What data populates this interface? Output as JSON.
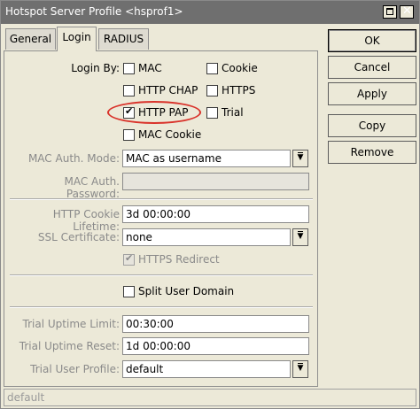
{
  "window": {
    "title": "Hotspot Server Profile <hsprof1>"
  },
  "tabs": [
    {
      "label": "General"
    },
    {
      "label": "Login"
    },
    {
      "label": "RADIUS"
    }
  ],
  "login": {
    "login_by_label": "Login By:",
    "options": {
      "mac": {
        "label": "MAC",
        "checked": false
      },
      "cookie": {
        "label": "Cookie",
        "checked": false
      },
      "http_chap": {
        "label": "HTTP CHAP",
        "checked": false
      },
      "https": {
        "label": "HTTPS",
        "checked": false
      },
      "http_pap": {
        "label": "HTTP PAP",
        "checked": true
      },
      "trial": {
        "label": "Trial",
        "checked": false
      },
      "mac_cookie": {
        "label": "MAC Cookie",
        "checked": false
      }
    },
    "mac_auth_mode": {
      "label": "MAC Auth. Mode:",
      "value": "MAC as username"
    },
    "mac_auth_password": {
      "label": "MAC Auth. Password:",
      "value": ""
    },
    "http_cookie_lifetime": {
      "label": "HTTP Cookie Lifetime:",
      "value": "3d 00:00:00"
    },
    "ssl_certificate": {
      "label": "SSL Certificate:",
      "value": "none"
    },
    "https_redirect": {
      "label": "HTTPS Redirect",
      "checked": true
    },
    "split_user_domain": {
      "label": "Split User Domain",
      "checked": false
    },
    "trial_uptime_limit": {
      "label": "Trial Uptime Limit:",
      "value": "00:30:00"
    },
    "trial_uptime_reset": {
      "label": "Trial Uptime Reset:",
      "value": "1d 00:00:00"
    },
    "trial_user_profile": {
      "label": "Trial User Profile:",
      "value": "default"
    }
  },
  "buttons": {
    "ok": "OK",
    "cancel": "Cancel",
    "apply": "Apply",
    "copy": "Copy",
    "remove": "Remove"
  },
  "status": {
    "text": "default"
  },
  "colors": {
    "highlight": "#d9322a",
    "titlebar": "#6f6f6f"
  }
}
